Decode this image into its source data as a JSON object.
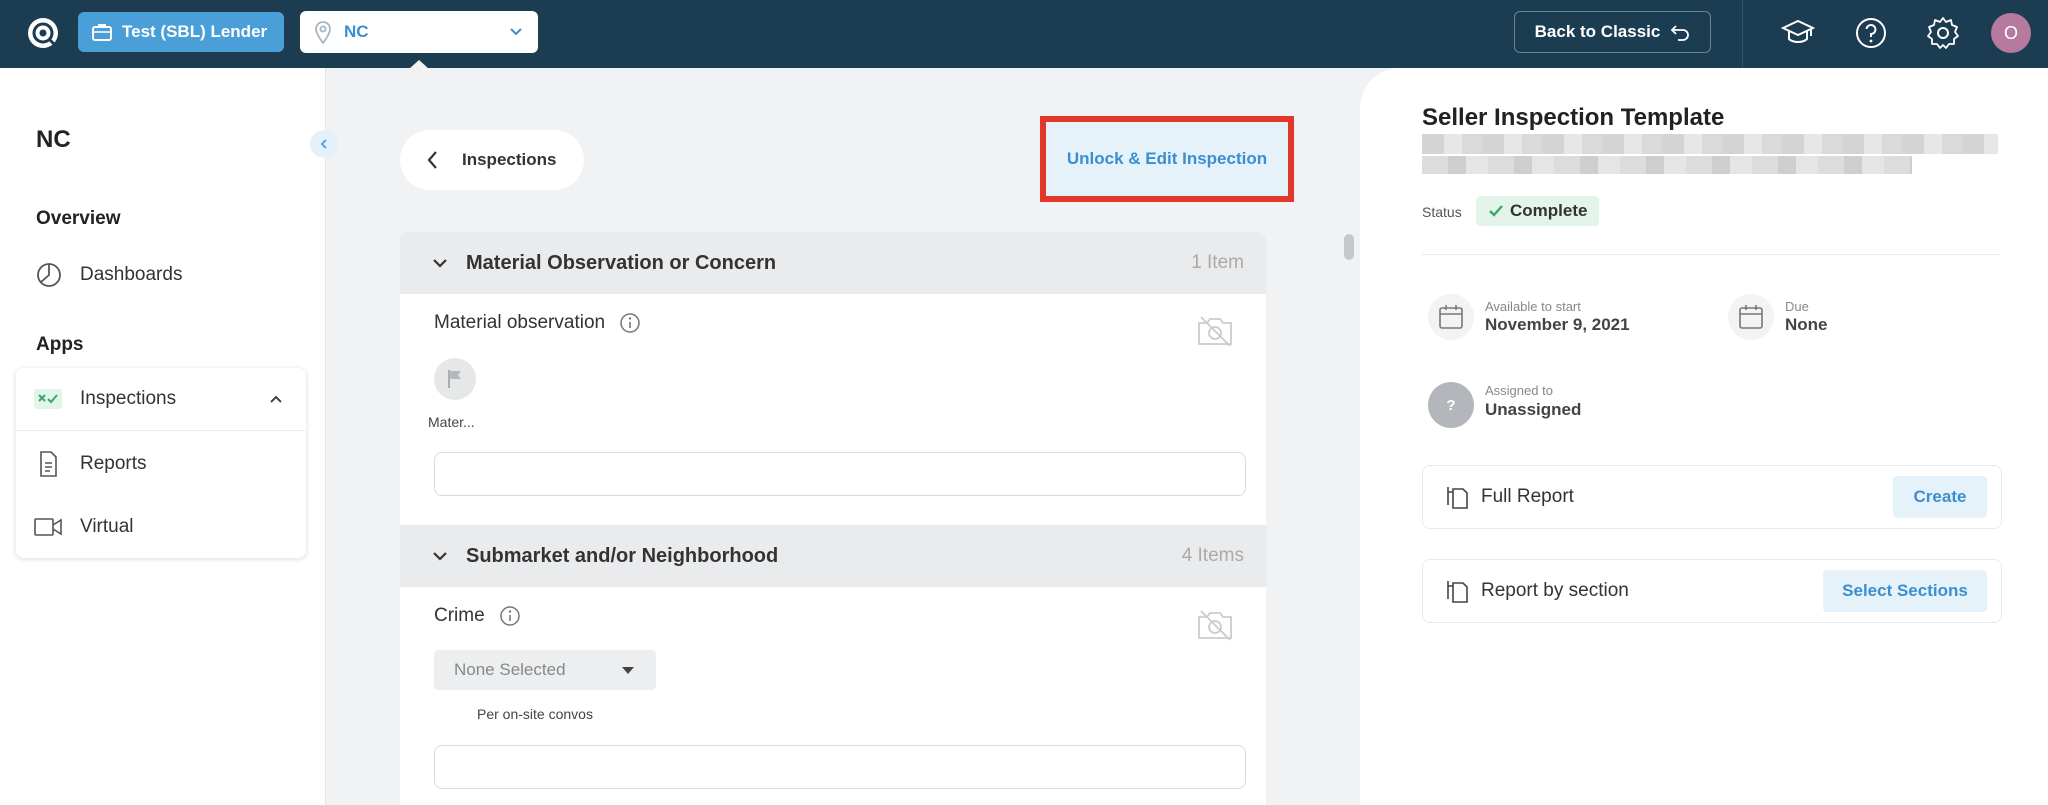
{
  "topbar": {
    "org_button": "Test (SBL) Lender",
    "location": "NC",
    "back_to_classic": "Back to Classic",
    "avatar_initial": "O"
  },
  "sidebar": {
    "title": "NC",
    "overview_heading": "Overview",
    "dashboards": "Dashboards",
    "apps_heading": "Apps",
    "apps": [
      "Inspections",
      "Reports",
      "Virtual"
    ]
  },
  "main": {
    "back_label": "Inspections",
    "unlock_button": "Unlock & Edit Inspection",
    "sections": [
      {
        "title": "Material Observation or Concern",
        "count": "1 Item",
        "question": "Material observation",
        "flag_label": "Mater..."
      },
      {
        "title": "Submarket and/or Neighborhood",
        "count": "4 Items",
        "question": "Crime",
        "dropdown_value": "None Selected",
        "note": "Per on-site convos"
      }
    ]
  },
  "right": {
    "title": "Seller Inspection Template",
    "status_label": "Status",
    "status_value": "Complete",
    "available_label": "Available to start",
    "available_value": "November 9, 2021",
    "due_label": "Due",
    "due_value": "None",
    "assigned_label": "Assigned to",
    "assigned_value": "Unassigned",
    "assigned_avatar": "?",
    "full_report": "Full Report",
    "create_btn": "Create",
    "report_by_section": "Report by section",
    "select_sections_btn": "Select Sections"
  },
  "colors": {
    "topbar": "#1c3c52",
    "accent": "#3b8fd0",
    "highlight_box": "#e2382a",
    "status_green": "#3aa864"
  }
}
